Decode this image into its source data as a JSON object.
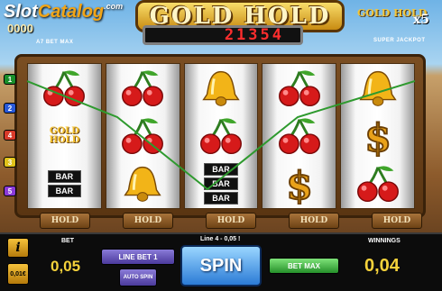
{
  "watermark": {
    "part1": "Slot",
    "part2": "Catalog",
    "suffix": ".com"
  },
  "header": {
    "coins_value": "0000",
    "bet_max_label": "A7 BET MAX",
    "title": "GOLD HOLD",
    "jackpot_value": "21354",
    "super_logo_text": "GOLD HOLD",
    "multiplier": "x5",
    "super_jackpot_label": "SUPER JACKPOT"
  },
  "reels": [
    [
      "cherry",
      "gold-hold",
      "bar-double"
    ],
    [
      "cherry",
      "cherry",
      "bell"
    ],
    [
      "bell",
      "cherry",
      "bar-triple"
    ],
    [
      "cherry",
      "cherry",
      "dollar"
    ],
    [
      "bell",
      "dollar",
      "cherry"
    ]
  ],
  "bar_label": "BAR",
  "line_markers": [
    {
      "label": "1",
      "color": "#1a8f2a"
    },
    {
      "label": "2",
      "color": "#2a5ad8"
    },
    {
      "label": "4",
      "color": "#d83a2a"
    },
    {
      "label": "3",
      "color": "#e0c21a"
    },
    {
      "label": "5",
      "color": "#8a3ad8"
    }
  ],
  "hold_labels": [
    "HOLD",
    "HOLD",
    "HOLD",
    "HOLD",
    "HOLD"
  ],
  "controls": {
    "info_label": "i",
    "coin_label": "0,01€",
    "bet_label": "BET",
    "bet_value": "0,05",
    "line_bet_label": "LINE BET 1",
    "auto_spin_label": "AUTO SPIN",
    "line_info": "Line 4 - 0,05 !",
    "spin_label": "SPIN",
    "bet_max_label": "BET MAX",
    "winnings_label": "WINNINGS",
    "winnings_value": "0,04"
  },
  "colors": {
    "payline": "#2e9a2e",
    "accent_gold": "#f5d23b"
  }
}
